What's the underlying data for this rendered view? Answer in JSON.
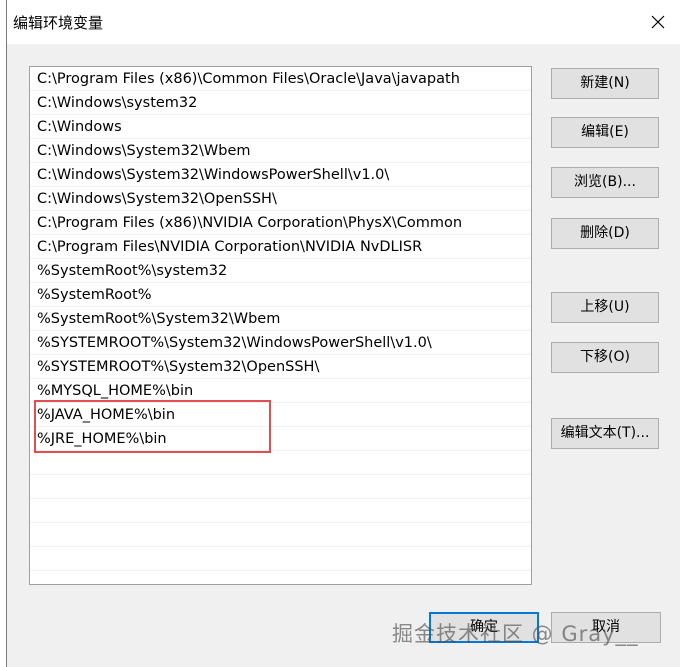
{
  "window": {
    "title": "编辑环境变量"
  },
  "path_list": {
    "items": [
      "C:\\Program Files (x86)\\Common Files\\Oracle\\Java\\javapath",
      "C:\\Windows\\system32",
      "C:\\Windows",
      "C:\\Windows\\System32\\Wbem",
      "C:\\Windows\\System32\\WindowsPowerShell\\v1.0\\",
      "C:\\Windows\\System32\\OpenSSH\\",
      "C:\\Program Files (x86)\\NVIDIA Corporation\\PhysX\\Common",
      "C:\\Program Files\\NVIDIA Corporation\\NVIDIA NvDLISR",
      "%SystemRoot%\\system32",
      "%SystemRoot%",
      "%SystemRoot%\\System32\\Wbem",
      "%SYSTEMROOT%\\System32\\WindowsPowerShell\\v1.0\\",
      "%SYSTEMROOT%\\System32\\OpenSSH\\",
      "%MYSQL_HOME%\\bin",
      "%JAVA_HOME%\\bin",
      "%JRE_HOME%\\bin"
    ]
  },
  "buttons": {
    "new": "新建(N)",
    "edit": "编辑(E)",
    "browse": "浏览(B)...",
    "delete": "删除(D)",
    "move_up": "上移(U)",
    "move_down": "下移(O)",
    "edit_text": "编辑文本(T)...",
    "ok": "确定",
    "cancel": "取消"
  },
  "watermark": "掘金技术社区 @ Gray__",
  "colors": {
    "highlight_border": "#e05050",
    "primary_button_border": "#0078d7"
  }
}
